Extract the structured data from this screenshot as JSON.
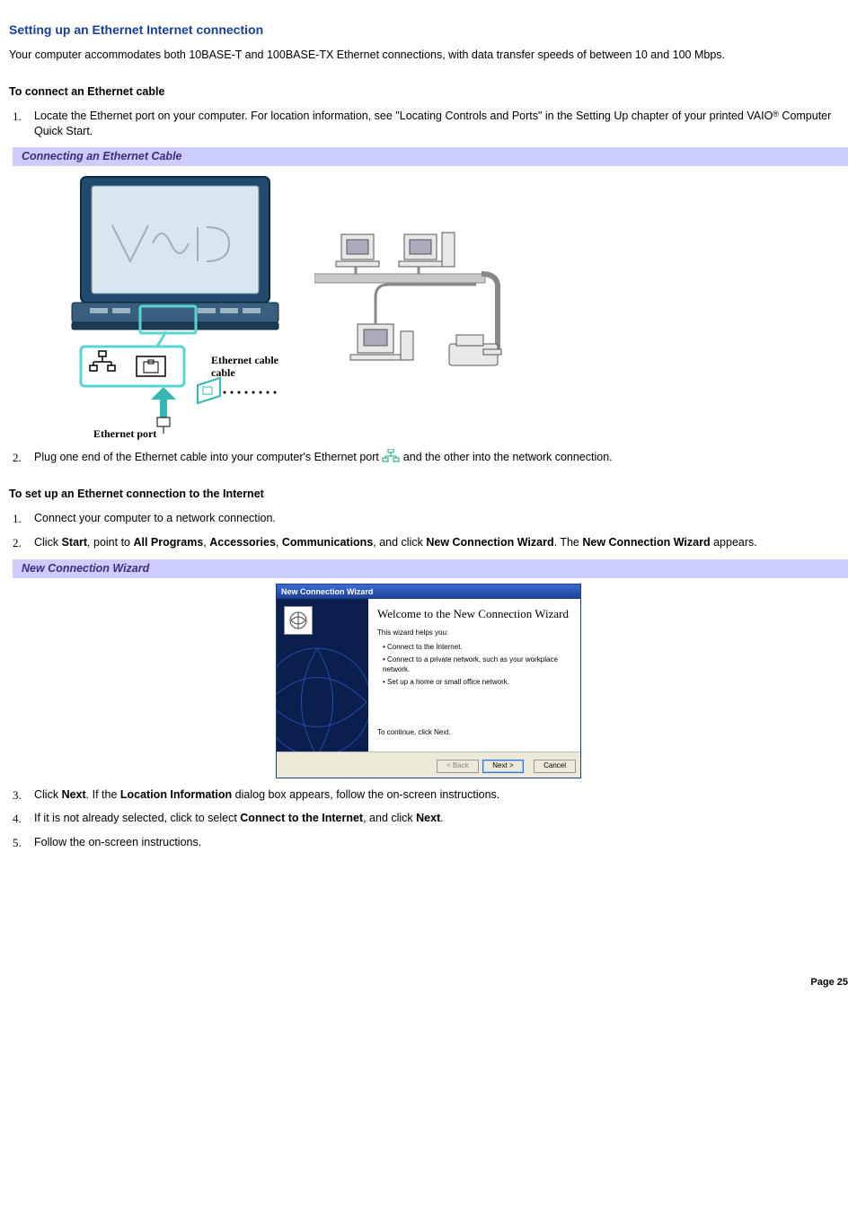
{
  "title": "Setting up an Ethernet Internet connection",
  "intro": "Your computer accommodates both 10BASE-T and 100BASE-TX Ethernet connections, with data transfer speeds of between 10 and 100 Mbps.",
  "section1": {
    "heading": "To connect an Ethernet cable",
    "item1_a": "Locate the Ethernet port on your computer. For location information, see \"Locating Controls and Ports\" in the Setting Up chapter of your printed VAIO",
    "item1_b": " Computer Quick Start.",
    "reg": "®",
    "captionBar": "Connecting an Ethernet Cable",
    "fig": {
      "ethernetCable": "Ethernet cable",
      "ethernetPort": "Ethernet port",
      "vaio": "VAIO"
    },
    "item2_a": "Plug one end of the Ethernet cable into your computer's Ethernet port ",
    "item2_b": "and the other into the network connection."
  },
  "section2": {
    "heading": "To set up an Ethernet connection to the Internet",
    "item1": "Connect your computer to a network connection.",
    "item2_a": "Click ",
    "item2_b": ", point to ",
    "item2_c": ", and click ",
    "item2_d": ". The ",
    "item2_e": " appears.",
    "bold": {
      "start": "Start",
      "allPrograms": "All Programs",
      "accessories": "Accessories",
      "communications": "Communications",
      "newConnWizard": "New Connection Wizard",
      "locationInfo": "Location Information",
      "connectInternet": "Connect to the Internet",
      "next": "Next"
    },
    "captionBar": "New Connection Wizard",
    "wizard": {
      "titlebar": "New Connection Wizard",
      "welcome": "Welcome to the New Connection Wizard",
      "helps": "This wizard helps you:",
      "b1": "Connect to the Internet.",
      "b2": "Connect to a private network, such as your workplace network.",
      "b3": "Set up a home or small office network.",
      "cont": "To continue, click Next.",
      "back": "< Back",
      "next": "Next >",
      "cancel": "Cancel"
    },
    "item3_a": "Click ",
    "item3_b": ". If the ",
    "item3_c": " dialog box appears, follow the on-screen instructions.",
    "item4_a": "If it is not already selected, click to select ",
    "item4_b": ", and click ",
    "item4_c": ".",
    "item5": "Follow the on-screen instructions."
  },
  "pageNum": "Page 25"
}
